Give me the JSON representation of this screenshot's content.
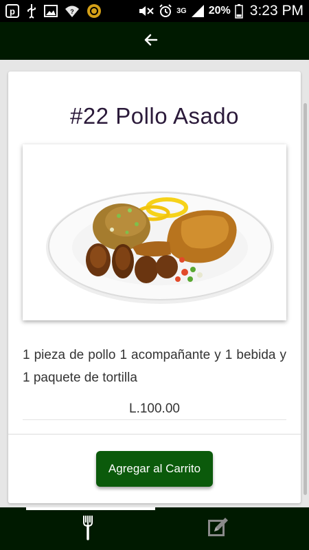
{
  "status_bar": {
    "battery_percent": "20%",
    "time": "3:23 PM",
    "network": "3G",
    "icons": [
      "p-app-icon",
      "usb-icon",
      "image-icon",
      "wifi-question-icon",
      "sync-icon",
      "mute-icon",
      "alarm-icon",
      "signal-icon",
      "battery-icon"
    ]
  },
  "app_bar": {
    "back_icon": "arrow-left-icon"
  },
  "product": {
    "title": "#22 Pollo Asado",
    "image": "roast-chicken-plate",
    "description": "1 pieza de pollo 1 acompañante y 1 bebida y 1 paquete de tortilla",
    "price": "L.100.00",
    "add_button_label": "Agregar al Carrito"
  },
  "bottom_nav": {
    "tabs": [
      {
        "icon": "fork-icon",
        "active": true
      },
      {
        "icon": "edit-note-icon",
        "active": false
      }
    ]
  },
  "colors": {
    "app_bar": "#001a00",
    "button": "#0b5a0b",
    "title_text": "#2b1a3a"
  }
}
